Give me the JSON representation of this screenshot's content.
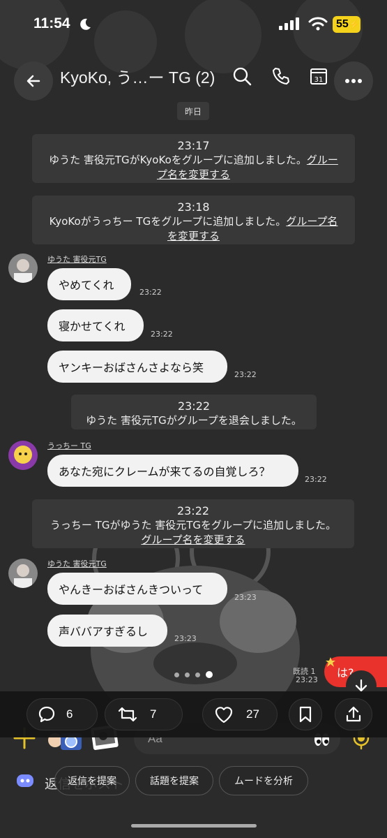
{
  "status_bar": {
    "time": "11:54",
    "battery": "55"
  },
  "header": {
    "title": "KyoKo, う…ー TG (2)"
  },
  "date_separator": "昨日",
  "system_messages": [
    {
      "time": "23:17",
      "text": "ゆうた 害役元TGがKyoKoをグループに追加しました。",
      "link_a": "グルー",
      "link_b": "プ名を変更する"
    },
    {
      "time": "23:18",
      "text": "KyoKoがうっちー TGをグループに追加しました。",
      "link_a": "グループ名",
      "link_b": "を変更する"
    },
    {
      "time": "23:22",
      "text": "ゆうた 害役元TGがグループを退会しました。"
    },
    {
      "time": "23:22",
      "text": "うっちー TGがゆうた 害役元TGをグループに追加しました。",
      "link_b": "グループ名を変更する"
    }
  ],
  "senders": {
    "yuta": "ゆうた 害役元TG",
    "ucchi": "うっちー TG"
  },
  "messages": [
    {
      "text": "やめてくれ",
      "time": "23:22"
    },
    {
      "text": "寝かせてくれ",
      "time": "23:22"
    },
    {
      "text": "ヤンキーおばさんさよなら笑",
      "time": "23:22"
    },
    {
      "text": "あなた宛にクレームが来てるの自覚しろ？",
      "time": "23:22"
    },
    {
      "text": "やんきーおばさんきついって",
      "time": "23:23"
    },
    {
      "text": "声ババアすぎるし",
      "time": "23:23"
    }
  ],
  "outgoing": {
    "text": "は?",
    "read": "既読 1",
    "time": "23:23"
  },
  "actions": {
    "replies": "6",
    "reposts": "7",
    "likes": "27"
  },
  "composer": {
    "placeholder": "Aa"
  },
  "suggestions": {
    "label": "返信をポスト",
    "chips": [
      "返信を提案",
      "話題を提案",
      "ムードを分析"
    ]
  },
  "icons": [
    "moon-icon",
    "signal-icon",
    "wifi-icon",
    "back-arrow-icon",
    "search-icon",
    "phone-icon",
    "calendar-icon",
    "more-icon",
    "scroll-down-icon",
    "reply-icon",
    "repost-icon",
    "heart-icon",
    "bookmark-icon",
    "share-icon",
    "plus-icon",
    "camera-icon",
    "photo-icon",
    "eyes-icon",
    "mic-icon",
    "ai-icon"
  ]
}
